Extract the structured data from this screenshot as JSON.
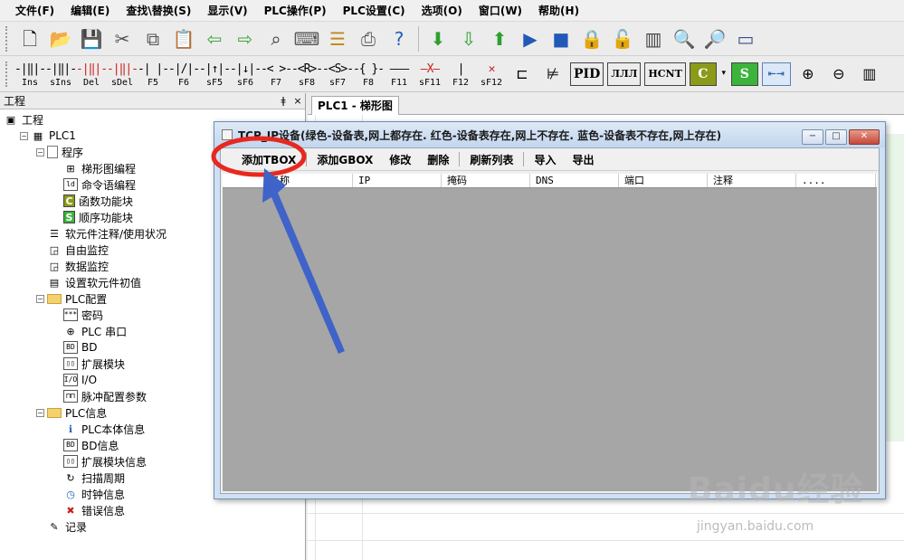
{
  "menu": [
    "文件(F)",
    "编辑(E)",
    "查找\\替换(S)",
    "显示(V)",
    "PLC操作(P)",
    "PLC设置(C)",
    "选项(O)",
    "窗口(W)",
    "帮助(H)"
  ],
  "toolbar1": {
    "icons": [
      "new-file-icon",
      "open-folder-icon",
      "save-icon",
      "cut-icon",
      "copy-icon",
      "paste-icon",
      "undo-arrow-icon",
      "redo-arrow-icon",
      "find-binoculars-icon",
      "keyboard-icon",
      "list-edit-icon",
      "print-icon",
      "help-search-icon",
      "download-icon",
      "upload-icon",
      "run-icon",
      "play-icon",
      "stop-icon",
      "lock-icon",
      "unlock-icon",
      "monitor-icon",
      "zoom-page-icon",
      "search-page-icon",
      "serial-port-icon"
    ]
  },
  "toolbar2": {
    "ladder_buttons": [
      {
        "symbol": "-|‖|-",
        "label": "Ins"
      },
      {
        "symbol": "-|‖|-",
        "label": "sIns"
      },
      {
        "symbol": "-|‖|-",
        "label": "Del"
      },
      {
        "symbol": "-|‖|-",
        "label": "sDel"
      },
      {
        "symbol": "-| |-",
        "label": "F5"
      },
      {
        "symbol": "-|/|-",
        "label": "F6"
      },
      {
        "symbol": "-|↑|-",
        "label": "sF5"
      },
      {
        "symbol": "-|↓|-",
        "label": "sF6"
      },
      {
        "symbol": "-< >-",
        "label": "F7"
      },
      {
        "symbol": "-<R>-",
        "label": "sF8"
      },
      {
        "symbol": "-<S>-",
        "label": "sF7"
      },
      {
        "symbol": "-{ }-",
        "label": "F8"
      },
      {
        "symbol": "———",
        "label": "F11"
      },
      {
        "symbol": "—X—",
        "label": "sF11"
      },
      {
        "symbol": "|",
        "label": "F12"
      },
      {
        "symbol": "✕",
        "label": "sF12"
      }
    ],
    "extra_buttons": [
      "PID",
      "ЛЛЛ",
      "HCNT",
      "C",
      "S"
    ]
  },
  "panel": {
    "title": "工程",
    "pin": "ǂ",
    "close": "×"
  },
  "tree": [
    {
      "label": "工程",
      "level": 0,
      "toggle": "",
      "icon": "project-icon",
      "glyph": "▣"
    },
    {
      "label": "PLC1",
      "level": 1,
      "toggle": "−",
      "icon": "plc-icon",
      "glyph": "▦"
    },
    {
      "label": "程序",
      "level": 2,
      "toggle": "−",
      "icon": "program-doc-icon",
      "glyph": ""
    },
    {
      "label": "梯形图编程",
      "level": 3,
      "toggle": "",
      "icon": "ladder-icon",
      "glyph": "⊞"
    },
    {
      "label": "命令语编程",
      "level": 3,
      "toggle": "",
      "icon": "instruction-icon",
      "glyph": "ld"
    },
    {
      "label": "函数功能块",
      "level": 3,
      "toggle": "",
      "icon": "function-block-c-icon",
      "glyph": "C"
    },
    {
      "label": "顺序功能块",
      "level": 3,
      "toggle": "",
      "icon": "sequence-block-s-icon",
      "glyph": "S"
    },
    {
      "label": "软元件注释/使用状况",
      "level": 2,
      "toggle": "",
      "icon": "comment-list-icon",
      "glyph": "☰"
    },
    {
      "label": "自由监控",
      "level": 2,
      "toggle": "",
      "icon": "free-monitor-icon",
      "glyph": "◲"
    },
    {
      "label": "数据监控",
      "level": 2,
      "toggle": "",
      "icon": "data-monitor-icon",
      "glyph": "◲"
    },
    {
      "label": "设置软元件初值",
      "level": 2,
      "toggle": "",
      "icon": "init-value-icon",
      "glyph": "▤"
    },
    {
      "label": "PLC配置",
      "level": 2,
      "toggle": "−",
      "icon": "folder-icon",
      "glyph": ""
    },
    {
      "label": "密码",
      "level": 3,
      "toggle": "",
      "icon": "password-icon",
      "glyph": "***"
    },
    {
      "label": "PLC 串口",
      "level": 3,
      "toggle": "",
      "icon": "serial-port-icon",
      "glyph": "⊕"
    },
    {
      "label": "BD",
      "level": 3,
      "toggle": "",
      "icon": "bd-icon",
      "glyph": "BD"
    },
    {
      "label": "扩展模块",
      "level": 3,
      "toggle": "",
      "icon": "expansion-module-icon",
      "glyph": "▯▯"
    },
    {
      "label": "I/O",
      "level": 3,
      "toggle": "",
      "icon": "io-icon",
      "glyph": "I/O"
    },
    {
      "label": "脉冲配置参数",
      "level": 3,
      "toggle": "",
      "icon": "pulse-config-icon",
      "glyph": "⊓⊓"
    },
    {
      "label": "PLC信息",
      "level": 2,
      "toggle": "−",
      "icon": "folder-icon",
      "glyph": ""
    },
    {
      "label": "PLC本体信息",
      "level": 3,
      "toggle": "",
      "icon": "plc-info-icon",
      "glyph": "ℹ"
    },
    {
      "label": "BD信息",
      "level": 3,
      "toggle": "",
      "icon": "bd-info-icon",
      "glyph": "BD"
    },
    {
      "label": "扩展模块信息",
      "level": 3,
      "toggle": "",
      "icon": "expansion-info-icon",
      "glyph": "▯▯"
    },
    {
      "label": "扫描周期",
      "level": 3,
      "toggle": "",
      "icon": "scan-cycle-icon",
      "glyph": "↻"
    },
    {
      "label": "时钟信息",
      "level": 3,
      "toggle": "",
      "icon": "clock-info-icon",
      "glyph": "◷"
    },
    {
      "label": "错误信息",
      "level": 3,
      "toggle": "",
      "icon": "error-info-icon",
      "glyph": "✖"
    },
    {
      "label": "记录",
      "level": 2,
      "toggle": "",
      "icon": "record-icon",
      "glyph": "✎"
    }
  ],
  "mdi_tab": "PLC1 - 梯形图",
  "dialog": {
    "title": "TCP_IP设备(绿色-设备表,网上都存在. 红色-设备表存在,网上不存在. 蓝色-设备表不存在,网上存在)",
    "controls": [
      "−",
      "□",
      "✕"
    ],
    "toolbar": [
      "添加TBOX",
      "添加GBOX",
      "修改",
      "删除",
      "刷新列表",
      "导入",
      "导出"
    ],
    "columns": [
      "",
      "名称",
      "IP",
      "掩码",
      "DNS",
      "端口",
      "注释",
      "...."
    ]
  },
  "annotation": {
    "circle_color": "#e8281e",
    "arrow_color": "#3f63c8"
  },
  "watermark": {
    "brand": "Baidu经验",
    "url": "jingyan.baidu.com"
  }
}
